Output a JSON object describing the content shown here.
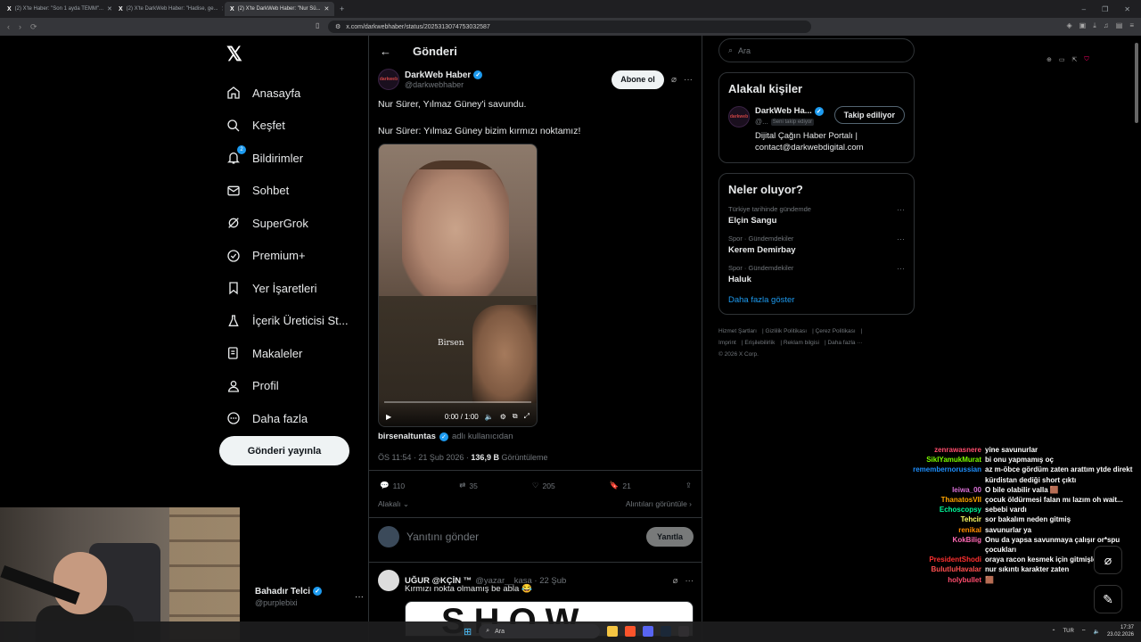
{
  "browser": {
    "tabs": [
      {
        "label": "(2) X'te Haber: \"Son 1 ayda TEMM\"..."
      },
      {
        "label": "(2) X'te DarkWeb Haber: \"Hadise, ge..."
      },
      {
        "label": "(2) X'te DarkWeb Haber: \"Nur Sü..."
      }
    ],
    "url": "x.com/darkwebhaber/status/2025313074753032587"
  },
  "nav": {
    "items": [
      {
        "label": "Anasayfa",
        "icon": "home-icon"
      },
      {
        "label": "Keşfet",
        "icon": "search-icon"
      },
      {
        "label": "Bildirimler",
        "icon": "bell-icon",
        "badge": "2"
      },
      {
        "label": "Sohbet",
        "icon": "mail-icon"
      },
      {
        "label": "SuperGrok",
        "icon": "grok-icon"
      },
      {
        "label": "Premium+",
        "icon": "premium-icon"
      },
      {
        "label": "Yer İşaretleri",
        "icon": "bookmark-icon"
      },
      {
        "label": "İçerik Üreticisi St...",
        "icon": "flask-icon"
      },
      {
        "label": "Makaleler",
        "icon": "article-icon"
      },
      {
        "label": "Profil",
        "icon": "person-icon"
      },
      {
        "label": "Daha fazla",
        "icon": "more-icon"
      }
    ],
    "post_button": "Gönderi yayınla",
    "account": {
      "name": "Bahadır Telci",
      "handle": "@purplebixi"
    }
  },
  "main": {
    "title": "Gönderi",
    "tweet": {
      "author_name": "DarkWeb Haber",
      "author_handle": "@darkwebhaber",
      "avatar_text": "darkweb",
      "subscribe_label": "Abone ol",
      "text_line1": "Nur Sürer, Yılmaz Güney'i savundu.",
      "text_line2": "Nur Sürer: Yılmaz Güney bizim kırmızı noktamız!",
      "video_time": "0:00 / 1:00",
      "video_watermark": "Birsen",
      "credit_user": "birsenaltuntas",
      "credit_suffix": "adlı kullanıcıdan",
      "timestamp": "ÖS 11:54 · 21 Şub 2026 ·",
      "views": "136,9 B",
      "views_label": "Görüntüleme",
      "replies": "110",
      "retweets": "35",
      "likes": "205",
      "bookmarks": "21",
      "related_label": "Alakalı",
      "quotes_label": "Alıntıları görüntüle"
    },
    "reply_box": {
      "placeholder": "Yanıtını gönder",
      "button": "Yanıtla"
    },
    "reply": {
      "name": "UĞUR @KÇİN ™",
      "handle": "@yazar__kasa · 22 Şub",
      "text": "Kırmızı nokta olmamış be abla 😂",
      "image_text": "SHOW"
    }
  },
  "sidebar": {
    "search_placeholder": "Ara",
    "related": {
      "title": "Alakalı kişiler",
      "name": "DarkWeb Ha...",
      "handle": "@...",
      "follows_you": "Seni takip ediyor",
      "follow_button": "Takip ediliyor",
      "bio": "Dijital Çağın Haber Portalı | contact@darkwebdigital.com"
    },
    "trends": {
      "title": "Neler oluyor?",
      "items": [
        {
          "context": "Türkiye tarihinde gündemde",
          "topic": "Elçin Sangu"
        },
        {
          "context": "Spor · Gündemdekiler",
          "topic": "Kerem Demirbay"
        },
        {
          "context": "Spor · Gündemdekiler",
          "topic": "Haluk"
        }
      ],
      "more": "Daha fazla göster"
    },
    "footer": {
      "links": [
        "Hizmet Şartları",
        "Gizlilik Politikası",
        "Çerez Politikası",
        "Imprint",
        "Erişilebilirlik",
        "Reklam bilgisi",
        "Daha fazla ···"
      ],
      "copyright": "© 2026 X Corp."
    }
  },
  "chat": [
    {
      "user": "zenrawasnere",
      "color": "#ff4d6d",
      "msg": "yine savunurlar"
    },
    {
      "user": "SikIYamukMurat",
      "color": "#7cfc00",
      "msg": "bi onu yapmamış oç"
    },
    {
      "user": "remembernorussian",
      "color": "#1e90ff",
      "msg": "az m-öbce gördüm zaten arattım ytde direkt kürdistan dediği short çıktı"
    },
    {
      "user": "leiwa_00",
      "color": "#da70d6",
      "msg": "O bile olabilir valla 🟫"
    },
    {
      "user": "ThanatosVII",
      "color": "#ffa500",
      "msg": "çocuk öldürmesi falan mı lazım oh wait..."
    },
    {
      "user": "Echoscopsy",
      "color": "#00fa9a",
      "msg": "sebebi vardı"
    },
    {
      "user": "Tehcir",
      "color": "#ffff66",
      "msg": "sor bakalım neden gitmiş"
    },
    {
      "user": "renikal",
      "color": "#ff8c00",
      "msg": "savunurlar ya"
    },
    {
      "user": "KokBilig",
      "color": "#ff69b4",
      "msg": "Onu da yapsa savunmaya çalışır or*spu çocukları"
    },
    {
      "user": "PresidentShodi",
      "color": "#ff3030",
      "msg": "oraya racon kesmek için gitmişler derler"
    },
    {
      "user": "BulutluHavalar",
      "color": "#ff5050",
      "msg": "nur sıkıntı karakter zaten"
    },
    {
      "user": "holybullet",
      "color": "#ff4d6d",
      "msg": "🟫"
    }
  ],
  "taskbar": {
    "search": "Ara",
    "lang": "TUR",
    "time": "17:37",
    "date": "23.02.2026"
  }
}
